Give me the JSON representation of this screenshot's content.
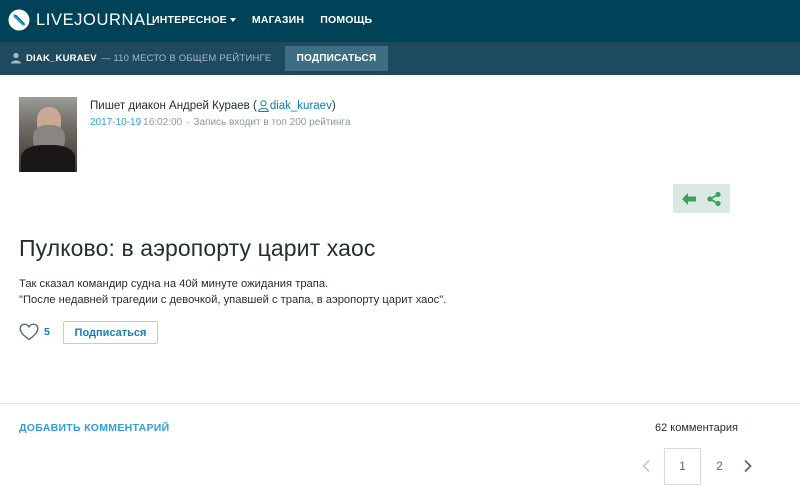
{
  "header": {
    "logo_text": "LIVEJOURNAL",
    "nav": [
      {
        "label": "ИНТЕРЕСНОЕ",
        "has_dropdown": true
      },
      {
        "label": "МАГАЗИН",
        "has_dropdown": false
      },
      {
        "label": "ПОМОЩЬ",
        "has_dropdown": false
      }
    ]
  },
  "journal_bar": {
    "username": "DIAK_KURAEV",
    "rank_text": "— 110 МЕСТО В ОБЩЕМ РЕЙТИНГЕ",
    "subscribe_label": "ПОДПИСАТЬСЯ"
  },
  "author": {
    "writes_prefix": "Пишет диакон Андрей Кураев (",
    "username": "diak_kuraev",
    "writes_suffix": ")",
    "date": "2017-10-19",
    "time": "16:02:00",
    "separator": "·",
    "rating_note": "Запись входит в топ 200 рейтинга"
  },
  "post": {
    "title": "Пулково: в аэропорту царит хаос",
    "body_lines": [
      "Так сказал командир судна на 40й минуте ожидания трапа.",
      "\"После недавней трагедии с девочкой, упавшей с трапа, в аэропорту царит хаос\"."
    ],
    "like_count": "5",
    "subscribe_label": "Подписаться"
  },
  "comments": {
    "add_label": "ДОБАВИТЬ КОММЕНТАРИЙ",
    "count_text": "62 комментария"
  },
  "pagination": {
    "pages": [
      "1",
      "2"
    ],
    "current": "1"
  },
  "colors": {
    "topbar": "#004359",
    "journalbar": "#1e4a60",
    "link": "#0e7bb8",
    "accent_green": "#3aa35a"
  }
}
